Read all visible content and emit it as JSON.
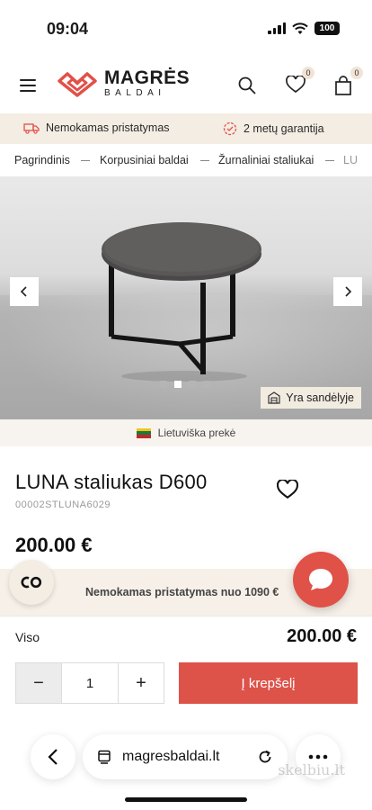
{
  "status_bar": {
    "time": "09:04",
    "battery": "100"
  },
  "header": {
    "logo_main": "MAGRĖS",
    "logo_sub": "BALDAI",
    "wishlist_count": "0",
    "cart_count": "0"
  },
  "benefits": {
    "delivery": "Nemokamas pristatymas",
    "warranty": "2 metų garantija"
  },
  "breadcrumb": [
    "Pagrindinis",
    "Korpusiniai baldai",
    "Žurnaliniai staliukai",
    "LU"
  ],
  "gallery": {
    "stock_label": "Yra sandėlyje",
    "image_count": 4,
    "active_index": 1
  },
  "origin": {
    "label": "Lietuviška prekė"
  },
  "product": {
    "title": "LUNA staliukas D600",
    "sku": "00002STLUNA6029",
    "price": "200.00 €"
  },
  "shipping_banner": {
    "text": "Nemokamas pristatymas nuo 1090 €"
  },
  "co_button": {
    "label": "CO"
  },
  "total": {
    "label": "Viso",
    "value": "200.00 €"
  },
  "quantity": {
    "value": "1",
    "minus": "−",
    "plus": "+"
  },
  "cart_button": {
    "label": "Į krepšelį"
  },
  "browser": {
    "domain": "magresbaldai.lt"
  },
  "watermark": "skelbiu.lt",
  "colors": {
    "accent": "#dd5249",
    "beige": "#f4ede4",
    "text": "#1c1c1c"
  }
}
